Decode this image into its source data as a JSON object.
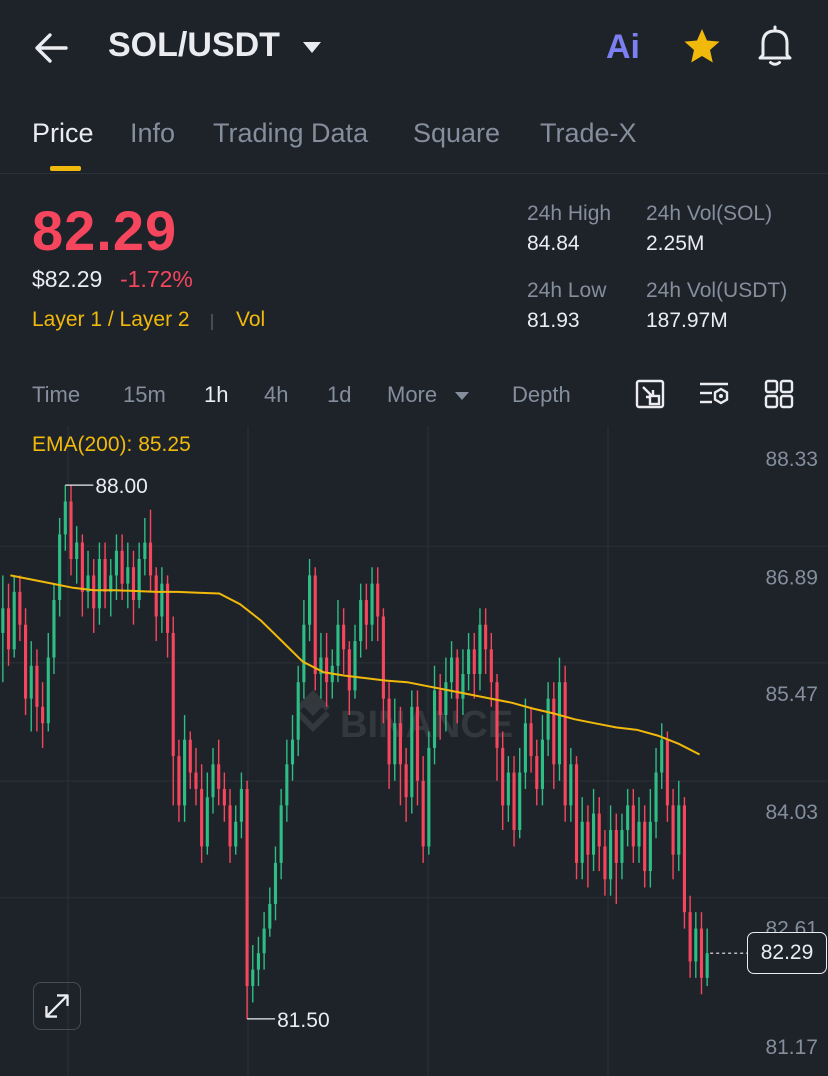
{
  "header": {
    "pair": "SOL/USDT",
    "ai_label": "Ai"
  },
  "tabs": [
    "Price",
    "Info",
    "Trading Data",
    "Square",
    "Trade-X"
  ],
  "price": {
    "last": "82.29",
    "usd": "$82.29",
    "change": "-1.72%",
    "category": "Layer 1 / Layer 2",
    "vol_tag": "Vol"
  },
  "stats": {
    "high_label": "24h High",
    "high_value": "84.84",
    "low_label": "24h Low",
    "low_value": "81.93",
    "vol_sol_label": "24h Vol(SOL)",
    "vol_sol_value": "2.25M",
    "vol_usdt_label": "24h Vol(USDT)",
    "vol_usdt_value": "187.97M"
  },
  "intervals": {
    "time": "Time",
    "m15": "15m",
    "h1": "1h",
    "h4": "4h",
    "d1": "1d",
    "more": "More",
    "depth": "Depth"
  },
  "chart": {
    "ema_label": "EMA(200): 85.25",
    "watermark": "BINANCE",
    "current_price": "82.29",
    "high_marker": "88.00",
    "low_marker": "81.50"
  },
  "colors": {
    "up": "#2ebd85",
    "down": "#f6465d",
    "ema": "#f0b90b",
    "accent": "#f0b90b",
    "background": "#1e2329"
  },
  "chart_data": {
    "type": "candlestick",
    "interval": "1h",
    "y_ticks": [
      "88.33",
      "86.89",
      "85.47",
      "84.03",
      "82.61",
      "81.17"
    ],
    "ylim": [
      81.17,
      88.33
    ],
    "annotations": [
      {
        "label": "88.00",
        "kind": "high"
      },
      {
        "label": "81.50",
        "kind": "low"
      }
    ],
    "ema_200": [
      86.9,
      86.85,
      86.8,
      86.75,
      86.72,
      86.72,
      86.71,
      86.7,
      86.7,
      86.69,
      86.68,
      86.55,
      86.35,
      86.1,
      85.85,
      85.72,
      85.68,
      85.65,
      85.62,
      85.6,
      85.55,
      85.5,
      85.45,
      85.4,
      85.35,
      85.28,
      85.22,
      85.15,
      85.1,
      85.05,
      85.02,
      84.95,
      84.85,
      84.72
    ],
    "candles": [
      [
        86.2,
        86.5,
        86.9,
        85.6
      ],
      [
        86.5,
        86.0,
        86.8,
        85.8
      ],
      [
        86.0,
        86.7,
        86.9,
        85.9
      ],
      [
        86.7,
        86.3,
        86.9,
        86.1
      ],
      [
        86.3,
        85.4,
        86.5,
        85.2
      ],
      [
        85.4,
        85.8,
        86.1,
        85.0
      ],
      [
        85.8,
        85.3,
        86.0,
        85.0
      ],
      [
        85.3,
        85.1,
        85.6,
        84.8
      ],
      [
        85.1,
        85.9,
        86.2,
        85.0
      ],
      [
        85.9,
        86.6,
        86.8,
        85.7
      ],
      [
        86.6,
        87.4,
        87.6,
        86.4
      ],
      [
        87.4,
        87.8,
        88.0,
        87.2
      ],
      [
        87.8,
        87.1,
        88.0,
        86.9
      ],
      [
        87.1,
        87.3,
        87.5,
        86.8
      ],
      [
        87.3,
        86.7,
        87.4,
        86.4
      ],
      [
        86.7,
        86.9,
        87.2,
        86.5
      ],
      [
        86.9,
        86.5,
        87.1,
        86.2
      ],
      [
        86.5,
        87.1,
        87.3,
        86.3
      ],
      [
        87.1,
        86.7,
        87.3,
        86.5
      ],
      [
        86.7,
        86.9,
        87.1,
        86.4
      ],
      [
        86.9,
        87.2,
        87.4,
        86.6
      ],
      [
        87.2,
        86.8,
        87.4,
        86.6
      ],
      [
        86.8,
        87.0,
        87.3,
        86.5
      ],
      [
        87.0,
        86.6,
        87.2,
        86.3
      ],
      [
        86.6,
        87.1,
        87.3,
        86.5
      ],
      [
        87.1,
        87.3,
        87.6,
        86.9
      ],
      [
        87.3,
        86.9,
        87.7,
        86.7
      ],
      [
        86.9,
        86.4,
        87.0,
        86.1
      ],
      [
        86.4,
        86.8,
        87.0,
        86.2
      ],
      [
        86.8,
        86.2,
        86.9,
        85.9
      ],
      [
        86.2,
        84.7,
        86.4,
        84.1
      ],
      [
        84.7,
        84.1,
        84.9,
        83.9
      ],
      [
        84.1,
        84.9,
        85.2,
        83.9
      ],
      [
        84.9,
        84.5,
        85.0,
        84.3
      ],
      [
        84.5,
        84.3,
        84.8,
        84.1
      ],
      [
        84.3,
        83.6,
        84.6,
        83.4
      ],
      [
        83.6,
        84.2,
        84.5,
        83.5
      ],
      [
        84.2,
        84.6,
        84.8,
        84.0
      ],
      [
        84.6,
        84.3,
        84.9,
        84.1
      ],
      [
        84.3,
        84.1,
        84.5,
        83.9
      ],
      [
        84.1,
        83.6,
        84.3,
        83.4
      ],
      [
        83.6,
        83.9,
        84.1,
        83.5
      ],
      [
        83.9,
        84.3,
        84.5,
        83.7
      ],
      [
        84.3,
        81.9,
        84.4,
        81.5
      ],
      [
        81.9,
        82.1,
        82.4,
        81.7
      ],
      [
        82.1,
        82.3,
        82.5,
        81.9
      ],
      [
        82.3,
        82.6,
        82.8,
        82.1
      ],
      [
        82.6,
        82.9,
        83.1,
        82.5
      ],
      [
        82.9,
        83.4,
        83.6,
        82.7
      ],
      [
        83.4,
        84.1,
        84.3,
        83.2
      ],
      [
        84.1,
        84.6,
        84.9,
        83.9
      ],
      [
        84.6,
        84.9,
        85.2,
        84.4
      ],
      [
        84.9,
        85.6,
        85.8,
        84.7
      ],
      [
        85.6,
        86.3,
        86.6,
        85.4
      ],
      [
        86.3,
        86.9,
        87.1,
        86.1
      ],
      [
        86.9,
        85.7,
        87.0,
        85.5
      ],
      [
        85.7,
        85.9,
        86.2,
        85.4
      ],
      [
        85.9,
        85.6,
        86.2,
        85.3
      ],
      [
        85.6,
        85.8,
        86.0,
        85.4
      ],
      [
        85.8,
        86.3,
        86.6,
        85.6
      ],
      [
        86.3,
        86.0,
        86.5,
        85.7
      ],
      [
        86.0,
        85.5,
        86.1,
        85.2
      ],
      [
        85.5,
        86.1,
        86.3,
        85.4
      ],
      [
        86.1,
        86.6,
        86.8,
        85.9
      ],
      [
        86.6,
        86.3,
        86.8,
        86.0
      ],
      [
        86.3,
        86.8,
        87.0,
        86.1
      ],
      [
        86.8,
        86.4,
        87.0,
        86.1
      ],
      [
        86.4,
        85.4,
        86.5,
        85.1
      ],
      [
        85.4,
        84.6,
        85.6,
        84.3
      ],
      [
        84.6,
        85.1,
        85.4,
        84.4
      ],
      [
        85.1,
        84.6,
        85.3,
        84.1
      ],
      [
        84.6,
        84.2,
        84.8,
        83.9
      ],
      [
        84.2,
        85.3,
        85.5,
        84.0
      ],
      [
        85.3,
        84.4,
        85.5,
        84.1
      ],
      [
        84.4,
        83.6,
        84.7,
        83.4
      ],
      [
        83.6,
        84.8,
        85.0,
        83.5
      ],
      [
        84.8,
        85.5,
        85.8,
        84.6
      ],
      [
        85.5,
        85.2,
        85.7,
        84.9
      ],
      [
        85.2,
        85.6,
        85.9,
        85.0
      ],
      [
        85.6,
        85.9,
        86.1,
        85.4
      ],
      [
        85.9,
        85.4,
        86.0,
        85.1
      ],
      [
        85.4,
        85.7,
        86.0,
        85.2
      ],
      [
        85.7,
        86.0,
        86.2,
        85.5
      ],
      [
        86.0,
        85.7,
        86.2,
        85.4
      ],
      [
        85.7,
        86.3,
        86.5,
        85.5
      ],
      [
        86.3,
        86.0,
        86.5,
        85.7
      ],
      [
        86.0,
        85.6,
        86.2,
        85.3
      ],
      [
        85.6,
        84.8,
        85.7,
        84.4
      ],
      [
        84.8,
        84.1,
        85.0,
        83.8
      ],
      [
        84.1,
        84.5,
        84.7,
        83.9
      ],
      [
        84.5,
        83.8,
        84.7,
        83.6
      ],
      [
        83.8,
        84.5,
        84.8,
        83.7
      ],
      [
        84.5,
        85.1,
        85.4,
        84.3
      ],
      [
        85.1,
        84.7,
        85.3,
        84.5
      ],
      [
        84.7,
        84.3,
        84.9,
        84.1
      ],
      [
        84.3,
        84.9,
        85.2,
        84.1
      ],
      [
        84.9,
        85.4,
        85.6,
        84.7
      ],
      [
        85.4,
        84.6,
        85.6,
        84.3
      ],
      [
        84.6,
        85.6,
        85.9,
        84.4
      ],
      [
        85.6,
        84.1,
        85.8,
        83.9
      ],
      [
        84.1,
        84.6,
        84.8,
        83.9
      ],
      [
        84.6,
        83.4,
        84.7,
        83.2
      ],
      [
        83.4,
        83.9,
        84.2,
        83.2
      ],
      [
        83.9,
        83.5,
        84.1,
        83.1
      ],
      [
        83.5,
        84.0,
        84.3,
        83.3
      ],
      [
        84.0,
        83.6,
        84.2,
        83.3
      ],
      [
        83.6,
        83.2,
        83.8,
        83.0
      ],
      [
        83.2,
        83.8,
        84.1,
        83.0
      ],
      [
        83.8,
        83.4,
        84.0,
        82.9
      ],
      [
        83.4,
        83.8,
        84.0,
        83.2
      ],
      [
        83.8,
        84.1,
        84.3,
        83.6
      ],
      [
        84.1,
        83.6,
        84.3,
        83.4
      ],
      [
        83.6,
        83.9,
        84.2,
        83.4
      ],
      [
        83.9,
        83.3,
        84.1,
        83.1
      ],
      [
        83.3,
        83.9,
        84.3,
        83.1
      ],
      [
        83.9,
        84.5,
        84.8,
        83.7
      ],
      [
        84.5,
        84.9,
        85.1,
        84.3
      ],
      [
        84.9,
        84.1,
        85.0,
        83.9
      ],
      [
        84.1,
        83.5,
        84.3,
        83.2
      ],
      [
        83.5,
        84.1,
        84.4,
        83.3
      ],
      [
        84.1,
        82.8,
        84.2,
        82.6
      ],
      [
        82.8,
        82.2,
        83.0,
        82.0
      ],
      [
        82.2,
        82.6,
        82.8,
        82.0
      ],
      [
        82.6,
        82.0,
        82.8,
        81.8
      ],
      [
        82.0,
        82.3,
        82.6,
        81.9
      ]
    ]
  }
}
